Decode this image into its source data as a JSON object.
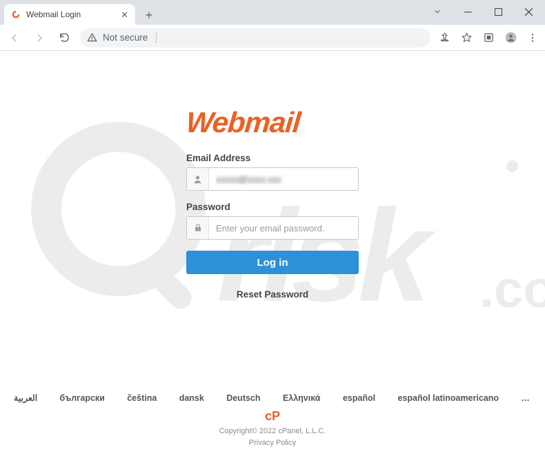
{
  "window": {
    "tab_title": "Webmail Login"
  },
  "address_bar": {
    "security_label": "Not secure"
  },
  "brand": {
    "name": "Webmail"
  },
  "form": {
    "email_label": "Email Address",
    "email_value": "xxxxx@xxxx.xxx",
    "password_label": "Password",
    "password_placeholder": "Enter your email password.",
    "login_label": "Log in",
    "reset_label": "Reset Password"
  },
  "languages": {
    "items": [
      "العربية",
      "български",
      "čeština",
      "dansk",
      "Deutsch",
      "Ελληνικά",
      "español",
      "español latinoamericano"
    ],
    "more": "…"
  },
  "footer": {
    "logo": "cP",
    "copyright": "Copyright© 2022 cPanel, L.L.C.",
    "privacy": "Privacy Policy"
  }
}
